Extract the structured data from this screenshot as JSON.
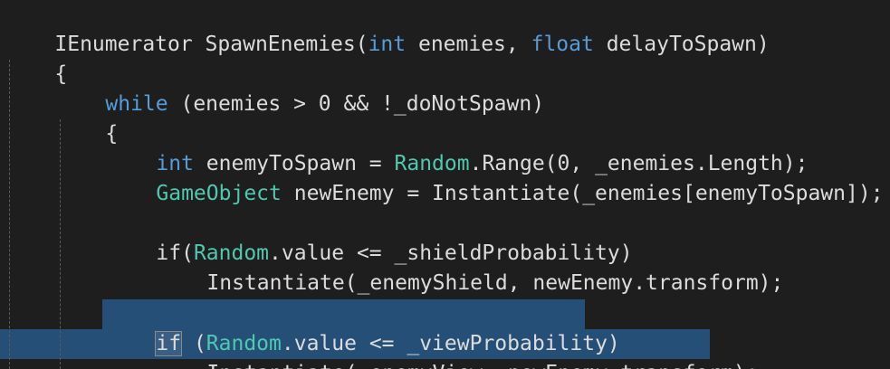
{
  "colors": {
    "background": "#1e1e1e",
    "text": "#dcdcdc",
    "keyword": "#569cd6",
    "type": "#4ec9b0",
    "selection": "#264f78",
    "indent_guide": "#5a5a5a"
  },
  "code": {
    "line1": {
      "t1": "IEnumerator SpawnEnemies(",
      "t2": "int",
      "t3": " enemies, ",
      "t4": "float",
      "t5": " delayToSpawn)"
    },
    "line2": {
      "t1": "{"
    },
    "line3": {
      "t1": "while",
      "t2": " (enemies > 0 && !_doNotSpawn)"
    },
    "line4": {
      "t1": "{"
    },
    "line5": {
      "t1": "int",
      "t2": " enemyToSpawn = ",
      "t3": "Random",
      "t4": ".Range(0, _enemies.Length);"
    },
    "line6": {
      "t1": "GameObject",
      "t2": " newEnemy = Instantiate(_enemies[enemyToSpawn]);"
    },
    "line7": {
      "t1": ""
    },
    "line8": {
      "t1": "if(",
      "t2": "Random",
      "t3": ".value <= _shieldProbability)"
    },
    "line9": {
      "t1": "Instantiate(_enemyShield, newEnemy.transform);"
    },
    "line10": {
      "t1": ""
    },
    "line11": {
      "t1": "if",
      "t2": " (",
      "t3": "Random",
      "t4": ".value <= _viewProbability)"
    },
    "line12": {
      "t1": "Instantiate(_enemyView, newEnemy.transform);"
    }
  }
}
